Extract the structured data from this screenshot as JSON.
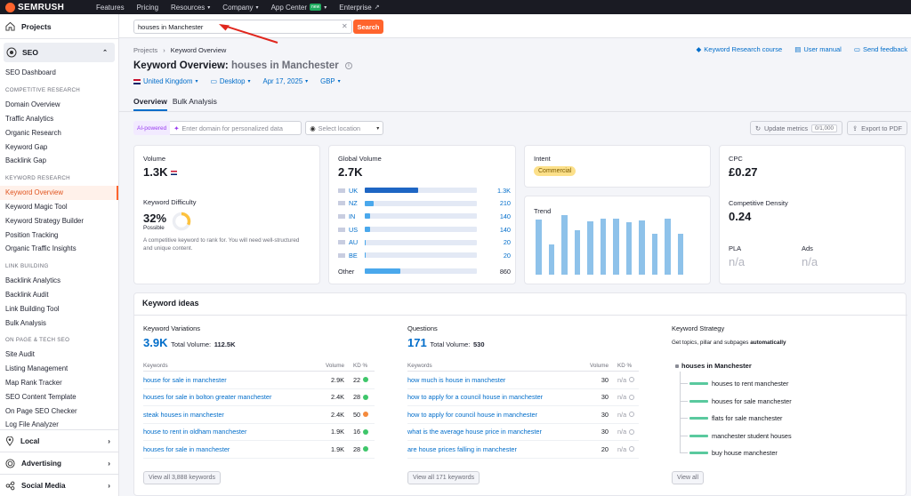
{
  "topbar": {
    "logo": "SEMRUSH",
    "nav": [
      {
        "label": "Features",
        "dd": false
      },
      {
        "label": "Pricing",
        "dd": false
      },
      {
        "label": "Resources",
        "dd": true
      },
      {
        "label": "Company",
        "dd": true
      },
      {
        "label": "App Center",
        "dd": true,
        "badge": "new"
      },
      {
        "label": "Enterprise",
        "dd": false,
        "ext": true
      }
    ]
  },
  "sidebar": {
    "projects": "Projects",
    "seo": "SEO",
    "dashboard": "SEO Dashboard",
    "sections": [
      {
        "head": "COMPETITIVE RESEARCH",
        "items": [
          "Domain Overview",
          "Traffic Analytics",
          "Organic Research",
          "Keyword Gap",
          "Backlink Gap"
        ]
      },
      {
        "head": "KEYWORD RESEARCH",
        "items": [
          "Keyword Overview",
          "Keyword Magic Tool",
          "Keyword Strategy Builder",
          "Position Tracking",
          "Organic Traffic Insights"
        ]
      },
      {
        "head": "LINK BUILDING",
        "items": [
          "Backlink Analytics",
          "Backlink Audit",
          "Link Building Tool",
          "Bulk Analysis"
        ]
      },
      {
        "head": "ON PAGE & TECH SEO",
        "items": [
          "Site Audit",
          "Listing Management",
          "Map Rank Tracker",
          "SEO Content Template",
          "On Page SEO Checker",
          "Log File Analyzer"
        ]
      }
    ],
    "active_item": "Keyword Overview",
    "groups": [
      "Local",
      "Advertising",
      "Social Media"
    ]
  },
  "search": {
    "value": "houses in Manchester",
    "button": "Search"
  },
  "breadcrumb": {
    "root": "Projects",
    "sep": "›",
    "current": "Keyword Overview"
  },
  "toplinks": {
    "course": "Keyword Research course",
    "manual": "User manual",
    "feedback": "Send feedback"
  },
  "title": {
    "prefix": "Keyword Overview:",
    "keyword": "houses in Manchester"
  },
  "filters": {
    "country": "United Kingdom",
    "device": "Desktop",
    "date": "Apr 17, 2025",
    "currency": "GBP"
  },
  "tabs": [
    "Overview",
    "Bulk Analysis"
  ],
  "tools": {
    "ai_badge": "AI-powered",
    "domain_placeholder": "Enter domain for personalized data",
    "location_placeholder": "Select location",
    "update": "Update metrics",
    "update_count": "0/1,000",
    "export": "Export to PDF"
  },
  "volume": {
    "label": "Volume",
    "value": "1.3K"
  },
  "difficulty": {
    "label": "Keyword Difficulty",
    "value": "32%",
    "percent": 32,
    "level": "Possible",
    "desc": "A competitive keyword to rank for. You will need well-structured and unique content."
  },
  "global_volume": {
    "label": "Global Volume",
    "value": "2.7K",
    "rows": [
      {
        "code": "UK",
        "value": "1.3K",
        "share": 0.48,
        "color": "#1e66c4"
      },
      {
        "code": "NZ",
        "value": "210",
        "share": 0.08,
        "color": "#4aa8ec"
      },
      {
        "code": "IN",
        "value": "140",
        "share": 0.05,
        "color": "#4aa8ec"
      },
      {
        "code": "US",
        "value": "140",
        "share": 0.05,
        "color": "#4aa8ec"
      },
      {
        "code": "AU",
        "value": "20",
        "share": 0.01,
        "color": "#4aa8ec"
      },
      {
        "code": "BE",
        "value": "20",
        "share": 0.01,
        "color": "#4aa8ec"
      }
    ],
    "other_label": "Other",
    "other_value": "860",
    "other_share": 0.32
  },
  "intent": {
    "label": "Intent",
    "value": "Commercial"
  },
  "trend": {
    "label": "Trend",
    "values": [
      0.78,
      0.42,
      0.84,
      0.62,
      0.75,
      0.79,
      0.79,
      0.74,
      0.76,
      0.58,
      0.79,
      0.58
    ]
  },
  "cpc": {
    "label": "CPC",
    "value": "£0.27"
  },
  "competitive_density": {
    "label": "Competitive Density",
    "value": "0.24"
  },
  "pla": {
    "label": "PLA",
    "value": "n/a"
  },
  "ads": {
    "label": "Ads",
    "value": "n/a"
  },
  "keyword_ideas": {
    "title": "Keyword ideas",
    "variations": {
      "label": "Keyword Variations",
      "count": "3.9K",
      "total_label": "Total Volume:",
      "total": "112.5K",
      "cols": [
        "Keywords",
        "Volume",
        "KD %"
      ],
      "rows": [
        {
          "kw": "house for sale in manchester",
          "vol": "2.9K",
          "kd": "22",
          "color": "#3ec66a"
        },
        {
          "kw": "houses for sale in bolton greater manchester",
          "vol": "2.4K",
          "kd": "28",
          "color": "#3ec66a"
        },
        {
          "kw": "steak houses in manchester",
          "vol": "2.4K",
          "kd": "50",
          "color": "#f48a3c"
        },
        {
          "kw": "house to rent in oldham manchester",
          "vol": "1.9K",
          "kd": "16",
          "color": "#3ec66a"
        },
        {
          "kw": "houses for sale in manchester",
          "vol": "1.9K",
          "kd": "28",
          "color": "#3ec66a"
        }
      ],
      "view_all": "View all 3,888 keywords"
    },
    "questions": {
      "label": "Questions",
      "count": "171",
      "total_label": "Total Volume:",
      "total": "530",
      "cols": [
        "Keywords",
        "Volume",
        "KD %"
      ],
      "rows": [
        {
          "kw": "how much is house in manchester",
          "vol": "30",
          "kd": "n/a"
        },
        {
          "kw": "how to apply for a council house in manchester",
          "vol": "30",
          "kd": "n/a"
        },
        {
          "kw": "how to apply for council house in manchester",
          "vol": "30",
          "kd": "n/a"
        },
        {
          "kw": "what is the average house price in manchester",
          "vol": "30",
          "kd": "n/a"
        },
        {
          "kw": "are house prices falling in manchester",
          "vol": "20",
          "kd": "n/a"
        }
      ],
      "view_all": "View all 171 keywords"
    },
    "strategy": {
      "label": "Keyword Strategy",
      "desc_prefix": "Get topics, pillar and subpages",
      "desc_bold": "automatically",
      "root": "houses in Manchester",
      "items": [
        "houses to rent manchester",
        "houses for sale manchester",
        "flats for sale manchester",
        "manchester student houses",
        "buy house manchester"
      ],
      "view_all": "View all"
    }
  },
  "colors": {
    "accent": "#ff642d",
    "link": "#006dca",
    "bar_primary": "#1e66c4",
    "bar_secondary": "#4aa8ec",
    "trend": "#8ec2ea"
  }
}
